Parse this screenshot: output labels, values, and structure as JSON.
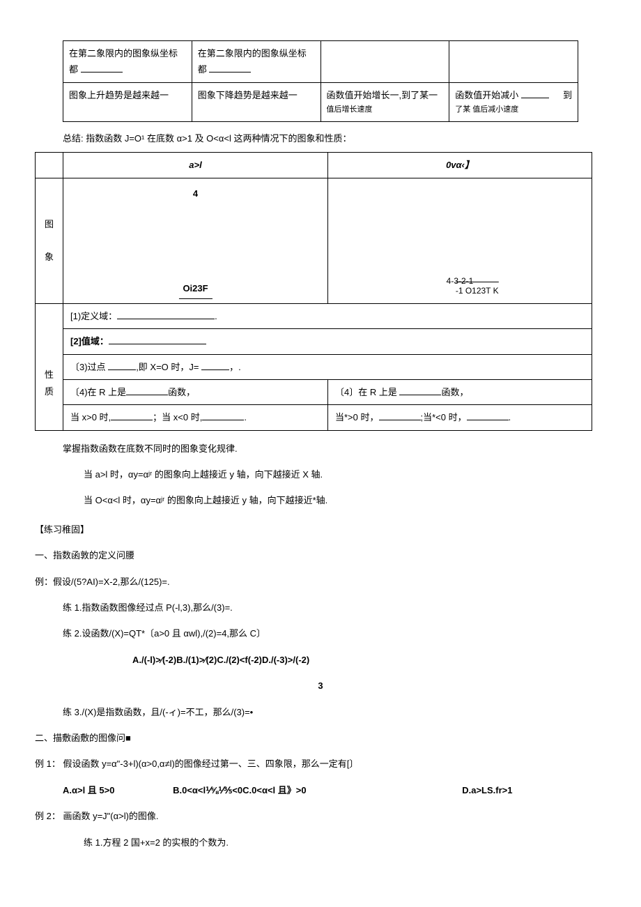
{
  "table1": {
    "r1c1": "在第二象限内的图象纵坐标都",
    "r1c2": "在第二象限内的图象纵坐标都",
    "r2c1": "图象上升趋势是越来越一",
    "r2c2": "图象下降趋势是越来越一",
    "r2c3a": "函数值开始增长一,到了某一",
    "r2c3b": "值后增长速度",
    "r2c4a": "函数值开始减小",
    "r2c4b": "到",
    "r2c4c": "了某   值后减小速度"
  },
  "summary": "总结:  指数函数 J=O¹ 在底数 α>1 及 O<α<l 这两种情况下的图象和性质：",
  "table2": {
    "h1": "a>l",
    "h2": "0vα‹】",
    "vlabel1a": "图",
    "vlabel1b": "象",
    "cell1_top": "4",
    "cell1_bot": "Oi23F",
    "cell2_bot_a": "4-3-2-1",
    "cell2_bot_b": "-1 O123T     K",
    "vlabel2a": "性",
    "vlabel2b": "质",
    "row1": "[1)定义域：",
    "row2": "[2]值域：",
    "row3a": "〔3)过点",
    "row3b": ",即 X=O 时，J=",
    "row3c": "，.",
    "row4L_a": "〔4)在 R 上是",
    "row4L_b": "函数，",
    "row4R_a": "〔4〕在 R 上是",
    "row4R_b": "函数，",
    "row5L_a": "当 x>0 时,",
    "row5L_b": "；当 x<0 时,",
    "row5R_a": "当*>0 时，",
    "row5R_b": ";当*<0 时，"
  },
  "notes": {
    "n1": "掌握指数函数在底数不同时的图象变化规律.",
    "n2": "当 a>l 时，αy=αʲʳ 的图象向上越接近 y 轴，向下越接近 X 轴.",
    "n3": "当 O<α<l 时，αy=αʲʳ 的图象向上越接近 y 轴，向下越接近*轴."
  },
  "practiceTitle": "【练习稚固】",
  "sec1": {
    "title": "一、指数函敦的定义问腰",
    "ex": "例：假设/(5?AI)=X-2,那么/(125)=.",
    "p1": "练 1.指数函数图像经过点 P(-l,3),那么/(3)=.",
    "p2": "练 2.设函数/(X)=QT*〔a>0 且 αwl),/(2)=4,那么 C〕",
    "opts": "A./(-l)>∕(-2)B./(1)>∕(2)C./(2)<f(-2)D./(-3)>/(-2)",
    "three": "3",
    "p3": "练 3./(X)是指数函数，且/(-ィ)=不工，那么/(3)=•"
  },
  "sec2": {
    "title": "二、描敷函敷的图像问■",
    "ex1": "例 1：  假设函数 y=α\"-3+l)(α>0,α≠l)的图像经过第一、三、四象限，那么一定有[〕",
    "optA": "A.α>l 且 5>0",
    "optBC": "B.0<α<l⅟⅝⅟⅗<0C.0<α<l 且》>0",
    "optD": "D.a>LS.fr>1",
    "ex2": "例 2：  画函数 y=J\"(α>l)的图像.",
    "p1": "练 1.方程 2 国+x=2 的实根的个数为."
  }
}
